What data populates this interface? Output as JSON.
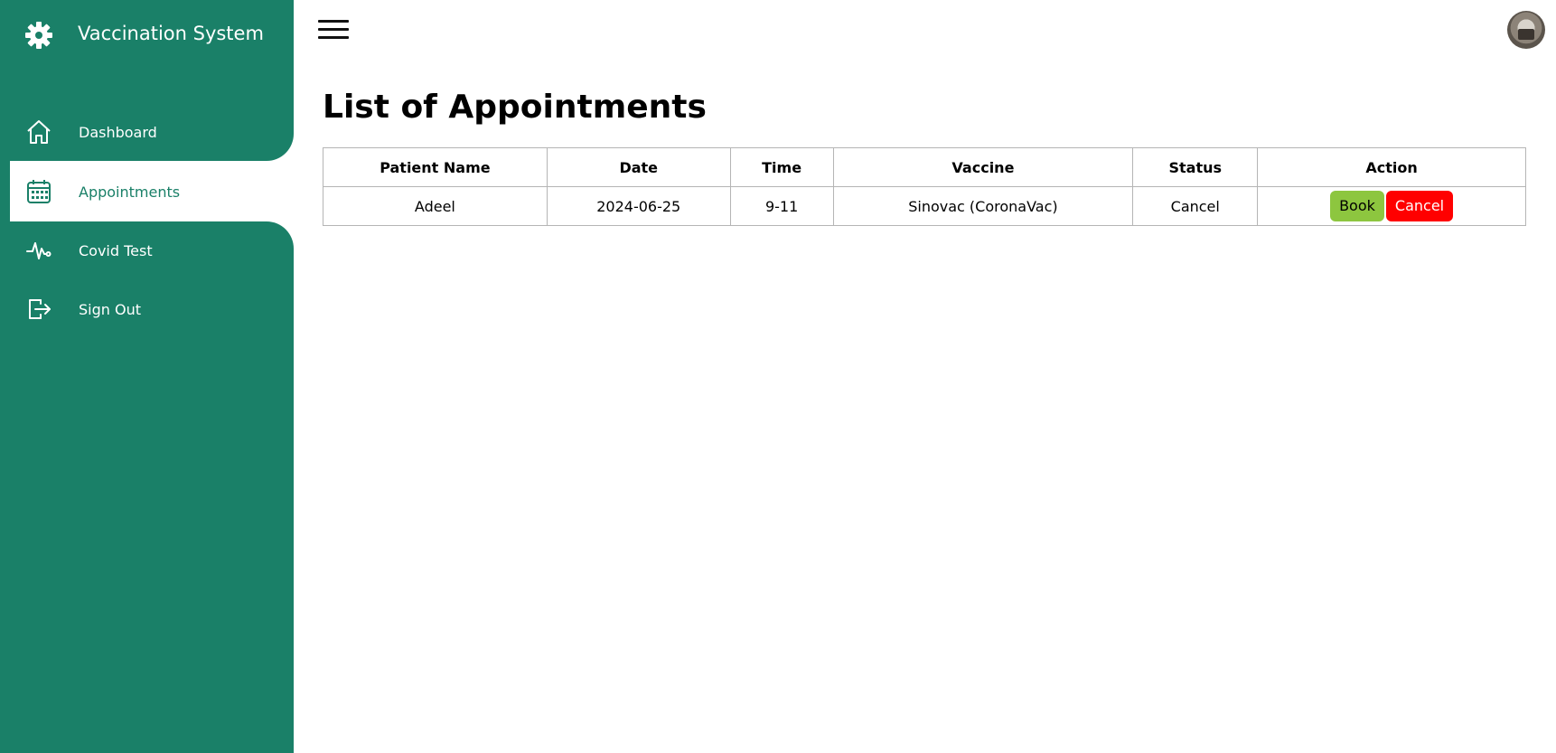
{
  "brand": {
    "title": "Vaccination System",
    "icon": "gear-icon"
  },
  "sidebar": {
    "items": [
      {
        "label": "Dashboard",
        "icon": "home-icon",
        "active": false
      },
      {
        "label": "Appointments",
        "icon": "calendar-icon",
        "active": true
      },
      {
        "label": "Covid Test",
        "icon": "pulse-icon",
        "active": false
      },
      {
        "label": "Sign Out",
        "icon": "sign-out-icon",
        "active": false
      }
    ]
  },
  "colors": {
    "sidebar": "#1a8068",
    "book": "#8dc63f",
    "cancel": "#ff0000"
  },
  "main": {
    "title": "List of Appointments",
    "table": {
      "headers": [
        "Patient Name",
        "Date",
        "Time",
        "Vaccine",
        "Status",
        "Action"
      ],
      "rows": [
        {
          "patient": "Adeel",
          "date": "2024-06-25",
          "time": "9-11",
          "vaccine": "Sinovac (CoronaVac)",
          "status": "Cancel",
          "actions": {
            "book": "Book",
            "cancel": "Cancel"
          }
        }
      ]
    }
  }
}
